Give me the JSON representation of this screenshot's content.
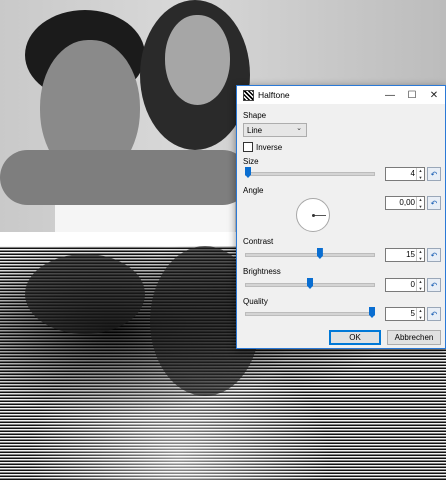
{
  "dialog": {
    "title": "Halftone",
    "title_buttons": {
      "minimize": "—",
      "maximize": "☐",
      "close": "✕"
    },
    "shape": {
      "label": "Shape",
      "value": "Line"
    },
    "inverse": {
      "label": "Inverse",
      "checked": false
    },
    "size": {
      "label": "Size",
      "value": "4",
      "fraction": 0.0
    },
    "angle": {
      "label": "Angle",
      "value": "0,00"
    },
    "contrast": {
      "label": "Contrast",
      "value": "15",
      "fraction": 0.58
    },
    "brightness": {
      "label": "Brightness",
      "value": "0",
      "fraction": 0.5
    },
    "quality": {
      "label": "Quality",
      "value": "5",
      "fraction": 1.0
    },
    "ok_label": "OK",
    "cancel_label": "Abbrechen"
  },
  "icons": {
    "reset": "↶",
    "spin_up": "▲",
    "spin_down": "▼",
    "dropdown": "⌄"
  }
}
